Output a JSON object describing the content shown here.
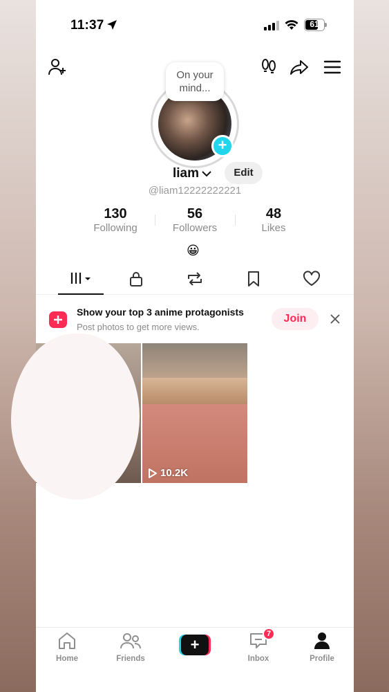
{
  "status_bar": {
    "time": "11:37",
    "battery": "61"
  },
  "profile": {
    "bubble_text": "On your mind...",
    "username": "liam",
    "edit_label": "Edit",
    "handle": "@liam12222222221",
    "stats": [
      {
        "value": "130",
        "label": "Following"
      },
      {
        "value": "56",
        "label": "Followers"
      },
      {
        "value": "48",
        "label": "Likes"
      }
    ],
    "bio_emoji": "😀"
  },
  "tabs": [
    "videos",
    "private",
    "reposts",
    "favorites",
    "liked"
  ],
  "promo": {
    "title": "Show your top 3 anime protagonists",
    "subtitle": "Post photos to get more views.",
    "join_label": "Join"
  },
  "videos": [
    {
      "views": ""
    },
    {
      "views": "10.2K"
    }
  ],
  "nav": {
    "items": [
      {
        "label": "Home"
      },
      {
        "label": "Friends"
      },
      {
        "label": ""
      },
      {
        "label": "Inbox"
      },
      {
        "label": "Profile"
      }
    ],
    "inbox_badge": "7"
  },
  "colors": {
    "accent": "#fe2c55",
    "cyan": "#20d5ec"
  }
}
